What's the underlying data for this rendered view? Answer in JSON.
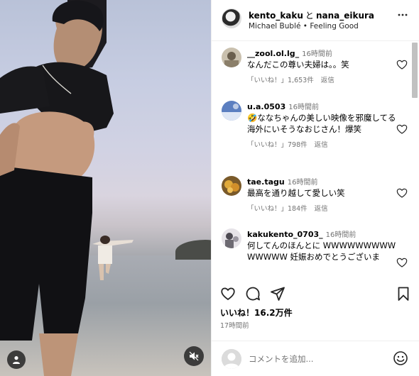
{
  "header": {
    "user1": "kento_kaku",
    "conjunction": "と",
    "user2": "nana_eikura",
    "song": "Michael Bublé • Feeling Good"
  },
  "comments": [
    {
      "user": "__zool.ol.lg_",
      "ago": "16時間前",
      "text": "なんだこの尊い夫婦は。。笑",
      "likes": "「いいね！」1,653件",
      "reply": "返信",
      "avatar_color": "#8b7f6a"
    },
    {
      "user": "u.a.0503",
      "ago": "16時間前",
      "text": "🤣ななちゃんの美しい映像を邪魔してる海外にいそうなおじさん！爆笑",
      "likes": "「いいね！」798件",
      "reply": "返信",
      "avatar_color": "#7a93c4"
    },
    {
      "user": "tae.tagu",
      "ago": "16時間前",
      "text": "最高を通り越して愛しい笑",
      "likes": "「いいね！」184件",
      "reply": "返信",
      "avatar_color": "#b8893a"
    },
    {
      "user": "kakukento_0703_",
      "ago": "16時間前",
      "text": "何してんのほんとに WWWWWWWWWWWWWW 妊娠おめでとうございま",
      "likes": "",
      "reply": "",
      "avatar_color": "#6d6a72"
    }
  ],
  "likes_line": "いいね！16.2万件",
  "posted_ago": "17時間前",
  "comment_input": {
    "placeholder": "コメントを追加..."
  },
  "icons": {
    "more": "more-horizontal-icon",
    "like": "heart-icon",
    "comment": "comment-icon",
    "share": "share-icon",
    "save": "bookmark-icon",
    "emoji": "smiley-icon",
    "mute": "speaker-muted-icon",
    "tagged": "person-icon"
  }
}
